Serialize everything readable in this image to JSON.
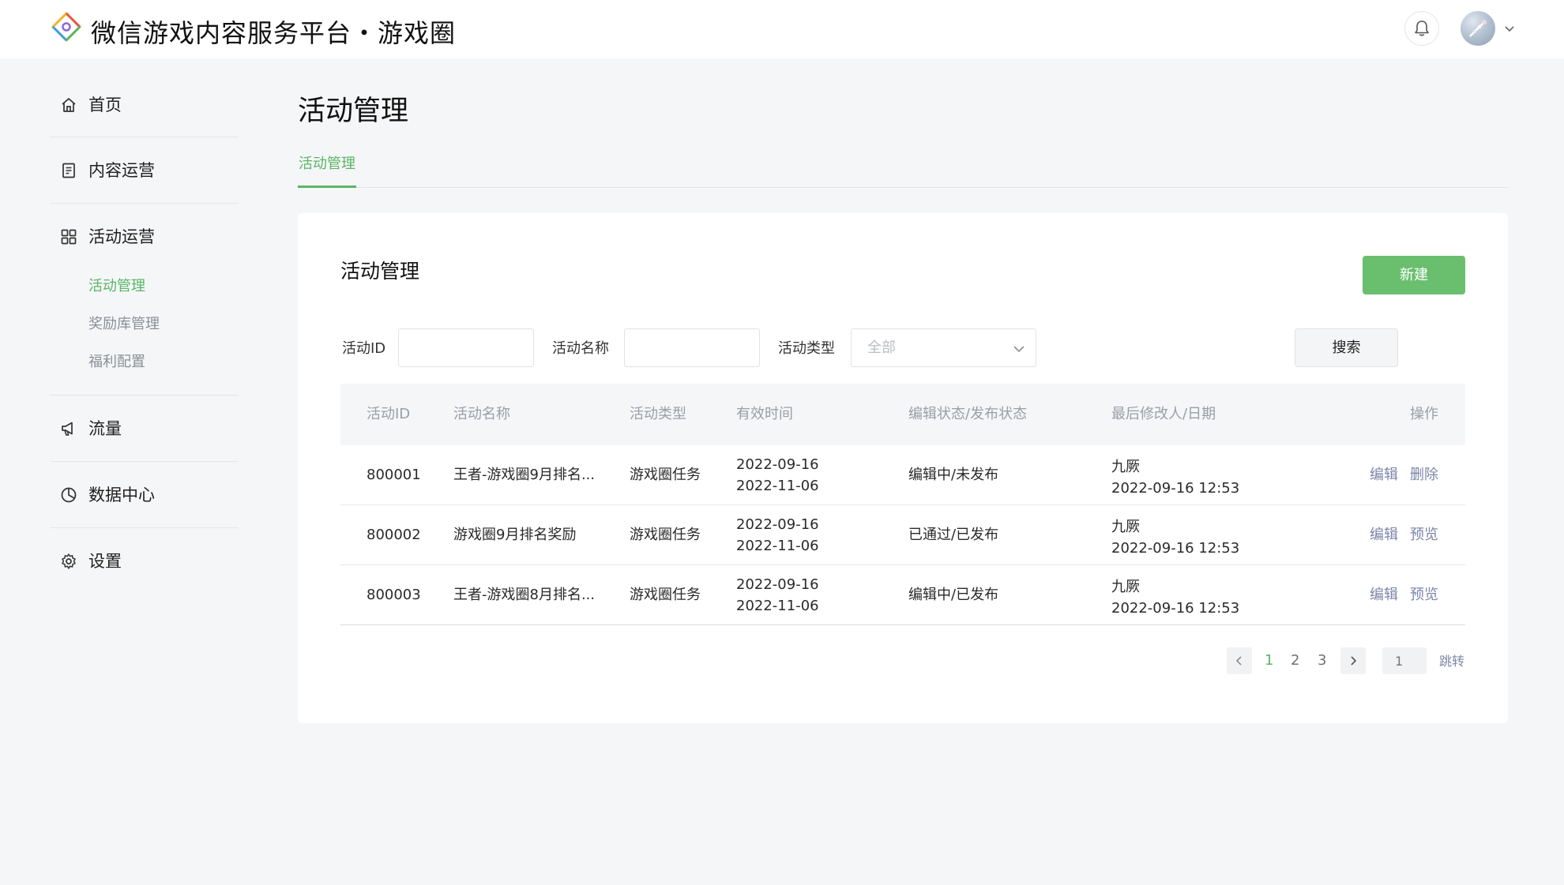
{
  "header": {
    "title": "微信游戏内容服务平台・游戏圈",
    "icons": [
      "logo-icon",
      "bell-icon",
      "avatar",
      "chevron-down-icon"
    ]
  },
  "sidebar": {
    "items": [
      {
        "label": "首页",
        "icon": "home-icon"
      },
      {
        "label": "内容运营",
        "icon": "document-icon"
      },
      {
        "label": "活动运营",
        "icon": "grid-icon",
        "children": [
          {
            "label": "活动管理",
            "active": true
          },
          {
            "label": "奖励库管理"
          },
          {
            "label": "福利配置"
          }
        ]
      },
      {
        "label": "流量",
        "icon": "megaphone-icon"
      },
      {
        "label": "数据中心",
        "icon": "pie-chart-icon"
      },
      {
        "label": "设置",
        "icon": "gear-icon"
      }
    ]
  },
  "main": {
    "page_title": "活动管理",
    "tabs": [
      {
        "label": "活动管理",
        "active": true
      }
    ],
    "card": {
      "title": "活动管理",
      "new_button": "新建",
      "filters": {
        "id_label": "活动ID",
        "id_value": "",
        "name_label": "活动名称",
        "name_value": "",
        "type_label": "活动类型",
        "type_value": "全部",
        "search_button": "搜索"
      },
      "table": {
        "columns": [
          "活动ID",
          "活动名称",
          "活动类型",
          "有效时间",
          "编辑状态/发布状态",
          "最后修改人/日期",
          "操作"
        ],
        "rows": [
          {
            "id": "800001",
            "name": "王者-游戏圈9月排名...",
            "type": "游戏圈任务",
            "start": "2022-09-16",
            "end": "2022-11-06",
            "status": "编辑中/未发布",
            "modifier": "九厥",
            "modified_at": "2022-09-16 12:53",
            "actions": [
              "编辑",
              "删除"
            ]
          },
          {
            "id": "800002",
            "name": "游戏圈9月排名奖励",
            "type": "游戏圈任务",
            "start": "2022-09-16",
            "end": "2022-11-06",
            "status": "已通过/已发布",
            "modifier": "九厥",
            "modified_at": "2022-09-16 12:53",
            "actions": [
              "编辑",
              "预览"
            ]
          },
          {
            "id": "800003",
            "name": "王者-游戏圈8月排名...",
            "type": "游戏圈任务",
            "start": "2022-09-16",
            "end": "2022-11-06",
            "status": "编辑中/已发布",
            "modifier": "九厥",
            "modified_at": "2022-09-16 12:53",
            "actions": [
              "编辑",
              "预览"
            ]
          }
        ]
      },
      "pagination": {
        "pages": [
          "1",
          "2",
          "3"
        ],
        "current_page": "1",
        "jump_placeholder": "1",
        "jump_label": "跳转"
      }
    }
  },
  "colors": {
    "accent": "#5ab567",
    "primary_button": "#6abf6e",
    "link": "#7c86a8",
    "background": "#f5f6f7"
  }
}
